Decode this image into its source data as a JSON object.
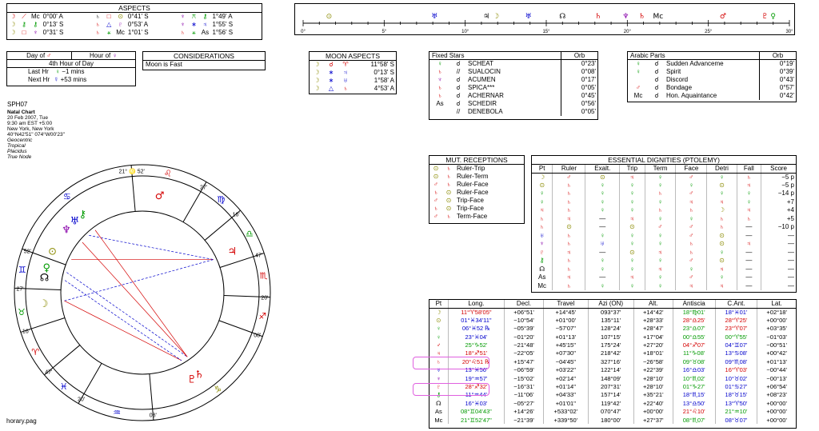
{
  "aspects": {
    "title": "ASPECTS",
    "rows": [
      [
        [
          "☽",
          "red"
        ],
        [
          "⟋",
          "red"
        ],
        [
          "Mc",
          "dk"
        ],
        "0°00' A",
        [
          "♄",
          "dk"
        ],
        [
          "□",
          "red"
        ],
        [
          "⊙",
          "olive"
        ],
        "0°41' S",
        [
          "♆",
          "purple"
        ],
        [
          "⚻",
          "green"
        ],
        [
          "⚷",
          "green"
        ],
        "1°49' A"
      ],
      [
        [
          "☽",
          "olive"
        ],
        [
          "⚷",
          "green"
        ],
        [
          "⚷",
          "green"
        ],
        "0°13' S",
        [
          "♄",
          "red"
        ],
        [
          "△",
          "blue"
        ],
        [
          "♇",
          "purple"
        ],
        "0°53' A",
        [
          "♆",
          "purple"
        ],
        [
          "∗",
          "blue"
        ],
        [
          "♃",
          "blue"
        ],
        "1°55' S"
      ],
      [
        [
          "☽",
          "olive"
        ],
        [
          "□",
          "red"
        ],
        [
          "♆",
          "purple"
        ],
        "0°31' S",
        [
          "♄",
          "red"
        ],
        [
          "⚹",
          "green"
        ],
        [
          "Mc",
          "dk"
        ],
        "1°01' S",
        [
          "♄",
          "red"
        ],
        [
          "⚹",
          "green"
        ],
        [
          "As",
          "dk"
        ],
        "1°56' S"
      ]
    ]
  },
  "degree_ruler": {
    "ticks": [
      "0°",
      "5°",
      "10°",
      "15°",
      "20°",
      "25°",
      "30°"
    ]
  },
  "hour_panel": {
    "day_of_label": "Day of",
    "hour_of_label": "Hour of",
    "hour_of_day": "4th Hour of Day",
    "last_hr_label": "Last Hr",
    "last_hr_value": "−1 mins",
    "next_hr_label": "Next Hr",
    "next_hr_value": "+53 mins"
  },
  "considerations": {
    "title": "CONSIDERATIONS",
    "text": "Moon is Fast"
  },
  "moon_aspects": {
    "title": "MOON ASPECTS",
    "rows": [
      [
        "☽",
        "☌",
        "♈",
        "11°58' S"
      ],
      [
        "☽",
        "∗",
        "♃",
        "0°13' S"
      ],
      [
        "☽",
        "∗",
        "♅",
        "1°58' A"
      ],
      [
        "☽",
        "△",
        "♄",
        "4°53' A"
      ]
    ]
  },
  "fixed_stars": {
    "title": "Fixed Stars",
    "orb_label": "Orb",
    "rows": [
      [
        "♀",
        "☌",
        "SCHEAT",
        "0°23'"
      ],
      [
        "♄",
        "//",
        "SUALOCIN",
        "0°08'"
      ],
      [
        "♆",
        "☌",
        "ACUMEN",
        "0°17'"
      ],
      [
        "♄",
        "☌",
        "SPICA***",
        "0°05'"
      ],
      [
        "♄",
        "☌",
        "ACHERNAR",
        "0°45'"
      ],
      [
        "As",
        "☌",
        "SCHEDIR",
        "0°56'"
      ],
      [
        "",
        "//",
        "DENEBOLA",
        "0°05'"
      ]
    ]
  },
  "arabic_parts": {
    "title": "Arabic Parts",
    "orb_label": "Orb",
    "rows": [
      [
        "♀",
        "☌",
        "Sudden Advanceme",
        "0°19'"
      ],
      [
        "♀",
        "☌",
        "Spirit",
        "0°39'"
      ],
      [
        "",
        "☌",
        "Discord",
        "0°43'"
      ],
      [
        "♂",
        "☌",
        "Bondage",
        "0°57'"
      ],
      [
        "Mc",
        "☌",
        "Hon. Aquaintance",
        "0°42'"
      ]
    ]
  },
  "chart_info": {
    "name": "SPH07",
    "type": "Natal Chart",
    "date": "20 Feb 2007, Tue",
    "time": "9:30 am  EST +5:00",
    "place": "New York, New York",
    "coords": "40°N42'51\" 074°W00'23\"",
    "zodiac": "Geocentric",
    "tropical": "Tropical",
    "houses": "Placidus",
    "node": "True Node",
    "file": "horary.pag"
  },
  "wheel": {
    "house_cusps": [
      "21° ♌ 52'",
      "27'",
      "16'",
      "47'",
      "20'",
      "08'",
      "08'",
      "20'",
      "47'",
      "16'",
      "27'",
      "52'"
    ],
    "signs_outer": [
      "♌",
      "♍",
      "♎",
      "♏",
      "♐",
      "♑",
      "♒",
      "♓",
      "♈",
      "♉",
      "♊",
      "♋"
    ]
  },
  "mut_receptions": {
    "title": "MUT. RECEPTIONS",
    "rows": [
      [
        "⊙",
        "♄",
        "Ruler-Trip"
      ],
      [
        "⊙",
        "♄",
        "Ruler-Term"
      ],
      [
        "♂",
        "♄",
        "Ruler-Face"
      ],
      [
        "♄",
        "⊙",
        "Ruler-Face"
      ],
      [
        "♂",
        "⊙",
        "Trip-Face"
      ],
      [
        "♄",
        "⊙",
        "Trip-Face"
      ],
      [
        "♂",
        "♄",
        "Term-Face"
      ]
    ]
  },
  "dignities": {
    "title": "ESSENTIAL DIGNITIES (PTOLEMY)",
    "headers": [
      "Pt",
      "Ruler",
      "Exalt.",
      "Trip",
      "Term",
      "Face",
      "Detri",
      "Fall",
      "Score"
    ],
    "rows": [
      [
        "☽",
        "♂",
        "⊙",
        "♃",
        "♀",
        "♂",
        "♀",
        "♄",
        "−5 p"
      ],
      [
        "⊙",
        "♄",
        "♀",
        "♀",
        "♀",
        "♀",
        "⊙",
        "♃",
        "−5 p"
      ],
      [
        "♀",
        "♄",
        "♀",
        "♀",
        "♄",
        "♂",
        "♀",
        "♀",
        "−14 p"
      ],
      [
        "♀",
        "♄",
        "♀",
        "♀",
        "♀",
        "♃",
        "♃",
        "♀",
        "+7"
      ],
      [
        "♃",
        "♄",
        "♀",
        "♀",
        "♄",
        "♄",
        "☽",
        "♃",
        "+4"
      ],
      [
        "♄",
        "♃",
        "—",
        "♃",
        "♀",
        "♀",
        "♄",
        "♄",
        "+5"
      ],
      [
        "♄",
        "⊙",
        "—",
        "⊙",
        "♂",
        "♂",
        "♄",
        "—",
        "−10 p"
      ],
      [
        "♅",
        "♄",
        "♀",
        "♀",
        "♀",
        "♂",
        "⊙",
        "—",
        "—"
      ],
      [
        "♆",
        "♄",
        "♅",
        "♀",
        "♀",
        "♄",
        "⊙",
        "♃",
        "—"
      ],
      [
        "♇",
        "♃",
        "—",
        "⊙",
        "♃",
        "♄",
        "♀",
        "—",
        "—"
      ],
      [
        "⚷",
        "♄",
        "♀",
        "♀",
        "♀",
        "♂",
        "⊙",
        "—",
        "—"
      ],
      [
        "☊",
        "♄",
        "♀",
        "♀",
        "♃",
        "♀",
        "♃",
        "—",
        "—"
      ],
      [
        "As",
        "♃",
        "—",
        "♃",
        "♀",
        "♂",
        "♀",
        "—",
        "—"
      ],
      [
        "Mc",
        "♄",
        "♀",
        "♀",
        "♀",
        "♃",
        "♃",
        "—",
        "—"
      ]
    ]
  },
  "positions": {
    "headers": [
      "Pt",
      "Long.",
      "Decl.",
      "Travel",
      "Azi (ON)",
      "Alt.",
      "Antiscia",
      "C.Ant.",
      "Lat."
    ],
    "rows": [
      [
        "☽",
        "11°♈58'05\"",
        "+06°51'",
        "+14°45'",
        "093°37'",
        "+14°42'",
        "18°♍01'",
        "18°♓01'",
        "+02°18'"
      ],
      [
        "⊙",
        "01°♓34'11\"",
        "−10°54'",
        "+01°00'",
        "135°11'",
        "+28°33'",
        "28°♎25'",
        "28°♈25'",
        "+00°00'"
      ],
      [
        "♀",
        "06°♓52 ℞",
        "−05°39'",
        "−57'07\"",
        "128°24'",
        "+28°47'",
        "23°♎07'",
        "23°♈07'",
        "+03°35'"
      ],
      [
        "♀",
        "23°♓04'",
        "−01°20'",
        "+01°13'",
        "107°15'",
        "+17°04'",
        "00°♎55'",
        "00°♈55'",
        "−01°03'"
      ],
      [
        "♂",
        "25°♑52'",
        "−21°48'",
        "+45'15\"",
        "175°24'",
        "+27°20'",
        "04°♐07'",
        "04°♊07'",
        "−00°51'"
      ],
      [
        "♃",
        "18°♐51'",
        "−22°05'",
        "+07'30\"",
        "218°42'",
        "+18°01'",
        "11°♑08'",
        "13°♋08'",
        "+00°42'"
      ],
      [
        "♄",
        "20°♌51 ℞",
        "+15°47'",
        "−04'45\"",
        "327°16'",
        "−26°58'",
        "09°♉08'",
        "09°♏08'",
        "+01°13'"
      ],
      [
        "♅",
        "13°♓56'",
        "−06°59'",
        "+03'22\"",
        "122°14'",
        "+22°39'",
        "16°♎03'",
        "16°♈03'",
        "−00°44'"
      ],
      [
        "♆",
        "19°♒57'",
        "−15°02'",
        "+02'14\"",
        "148°09'",
        "+28°10'",
        "10°♏02'",
        "10°♉02'",
        "−00°13'"
      ],
      [
        "♇",
        "28°♐32'",
        "−16°31'",
        "+01'14\"",
        "207°31'",
        "+28°10'",
        "01°♑27'",
        "01°♋27'",
        "+06°54'"
      ],
      [
        "⚷",
        "11°♒44'",
        "−11°06'",
        "+04'33\"",
        "157°14'",
        "+35°21'",
        "18°♏15'",
        "18°♉15'",
        "+08°23'"
      ],
      [
        "☊",
        "16°♓03'",
        "−05°27'",
        "+01'01\"",
        "119°42'",
        "+22°40'",
        "13°♎50'",
        "13°♈50'",
        "+00°00'"
      ],
      [
        "As",
        "08°♊04'43\"",
        "+14°26'",
        "+533°02'",
        "070°47'",
        "+00°00'",
        "21°♌10'",
        "21°♒10'",
        "+00°00'"
      ],
      [
        "Mc",
        "21°♊52'47\"",
        "−21°39'",
        "+339°50'",
        "180°00'",
        "+27°37'",
        "08°♏07'",
        "08°♉07'",
        "+00°00'"
      ]
    ]
  }
}
